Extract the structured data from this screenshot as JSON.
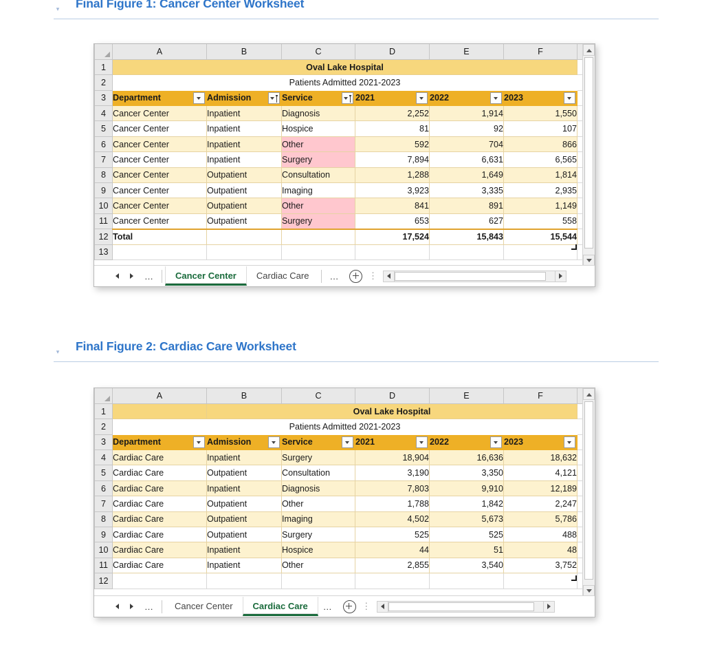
{
  "sections": [
    {
      "caret": "▾",
      "title": "Final Figure 1: Cancer Center Worksheet"
    },
    {
      "caret": "▾",
      "title": "Final Figure 2: Cardiac Care Worksheet"
    }
  ],
  "column_letters": [
    "A",
    "B",
    "C",
    "D",
    "E",
    "F"
  ],
  "figure1": {
    "title": "Oval Lake Hospital",
    "subtitle": "Patients Admitted 2021-2023",
    "row_numbers": [
      "1",
      "2",
      "3",
      "4",
      "5",
      "6",
      "7",
      "8",
      "9",
      "10",
      "11",
      "12",
      "13"
    ],
    "headers": [
      {
        "label": "Department",
        "filter": "dropdown"
      },
      {
        "label": "Admission",
        "filter": "sort-dropdown"
      },
      {
        "label": "Service",
        "filter": "sort-dropdown"
      },
      {
        "label": "2021",
        "filter": "dropdown"
      },
      {
        "label": "2022",
        "filter": "dropdown"
      },
      {
        "label": "2023",
        "filter": "dropdown"
      }
    ],
    "rows": [
      {
        "department": "Cancer Center",
        "admission": "Inpatient",
        "service": "Diagnosis",
        "y2021": "2,252",
        "y2022": "1,914",
        "y2023": "1,550",
        "flagged": false
      },
      {
        "department": "Cancer Center",
        "admission": "Inpatient",
        "service": "Hospice",
        "y2021": "81",
        "y2022": "92",
        "y2023": "107",
        "flagged": false
      },
      {
        "department": "Cancer Center",
        "admission": "Inpatient",
        "service": "Other",
        "y2021": "592",
        "y2022": "704",
        "y2023": "866",
        "flagged": true
      },
      {
        "department": "Cancer Center",
        "admission": "Inpatient",
        "service": "Surgery",
        "y2021": "7,894",
        "y2022": "6,631",
        "y2023": "6,565",
        "flagged": true
      },
      {
        "department": "Cancer Center",
        "admission": "Outpatient",
        "service": "Consultation",
        "y2021": "1,288",
        "y2022": "1,649",
        "y2023": "1,814",
        "flagged": false
      },
      {
        "department": "Cancer Center",
        "admission": "Outpatient",
        "service": "Imaging",
        "y2021": "3,923",
        "y2022": "3,335",
        "y2023": "2,935",
        "flagged": false
      },
      {
        "department": "Cancer Center",
        "admission": "Outpatient",
        "service": "Other",
        "y2021": "841",
        "y2022": "891",
        "y2023": "1,149",
        "flagged": true
      },
      {
        "department": "Cancer Center",
        "admission": "Outpatient",
        "service": "Surgery",
        "y2021": "653",
        "y2022": "627",
        "y2023": "558",
        "flagged": true
      }
    ],
    "total": {
      "label": "Total",
      "admission": "",
      "service": "",
      "y2021": "17,524",
      "y2022": "15,843",
      "y2023": "15,544"
    },
    "tabs": [
      {
        "label": "Cancer Center",
        "active": true
      },
      {
        "label": "Cardiac Care",
        "active": false
      }
    ],
    "tab_overflow": "…",
    "nav_ellipsis": "…"
  },
  "figure2": {
    "title": "Oval Lake Hospital",
    "subtitle": "Patients Admitted 2021-2023",
    "row_numbers": [
      "1",
      "2",
      "3",
      "4",
      "5",
      "6",
      "7",
      "8",
      "9",
      "10",
      "11",
      "12"
    ],
    "headers": [
      {
        "label": "Department",
        "filter": "dropdown"
      },
      {
        "label": "Admission",
        "filter": "dropdown"
      },
      {
        "label": "Service",
        "filter": "dropdown"
      },
      {
        "label": "2021",
        "filter": "dropdown"
      },
      {
        "label": "2022",
        "filter": "dropdown"
      },
      {
        "label": "2023",
        "filter": "dropdown"
      }
    ],
    "rows": [
      {
        "department": "Cardiac Care",
        "admission": "Inpatient",
        "service": "Surgery",
        "y2021": "18,904",
        "y2022": "16,636",
        "y2023": "18,632",
        "flagged": false
      },
      {
        "department": "Cardiac Care",
        "admission": "Outpatient",
        "service": "Consultation",
        "y2021": "3,190",
        "y2022": "3,350",
        "y2023": "4,121",
        "flagged": false
      },
      {
        "department": "Cardiac Care",
        "admission": "Inpatient",
        "service": "Diagnosis",
        "y2021": "7,803",
        "y2022": "9,910",
        "y2023": "12,189",
        "flagged": false
      },
      {
        "department": "Cardiac Care",
        "admission": "Outpatient",
        "service": "Other",
        "y2021": "1,788",
        "y2022": "1,842",
        "y2023": "2,247",
        "flagged": false
      },
      {
        "department": "Cardiac Care",
        "admission": "Outpatient",
        "service": "Imaging",
        "y2021": "4,502",
        "y2022": "5,673",
        "y2023": "5,786",
        "flagged": false
      },
      {
        "department": "Cardiac Care",
        "admission": "Outpatient",
        "service": "Surgery",
        "y2021": "525",
        "y2022": "525",
        "y2023": "488",
        "flagged": false
      },
      {
        "department": "Cardiac Care",
        "admission": "Inpatient",
        "service": "Hospice",
        "y2021": "44",
        "y2022": "51",
        "y2023": "48",
        "flagged": false
      },
      {
        "department": "Cardiac Care",
        "admission": "Inpatient",
        "service": "Other",
        "y2021": "2,855",
        "y2022": "3,540",
        "y2023": "3,752",
        "flagged": false
      }
    ],
    "tabs": [
      {
        "label": "Cancer Center",
        "active": false
      },
      {
        "label": "Cardiac Care",
        "active": true
      }
    ],
    "tab_overflow": "…",
    "nav_ellipsis": "…"
  },
  "colors": {
    "section_title": "#2e75c9",
    "table_header": "#eeb026",
    "title_band": "#f7d77d",
    "banded_row": "#fdf2cf",
    "bad_fill": "#ffc7ce",
    "bad_text": "#9c0006",
    "active_tab": "#1a6b3c"
  }
}
